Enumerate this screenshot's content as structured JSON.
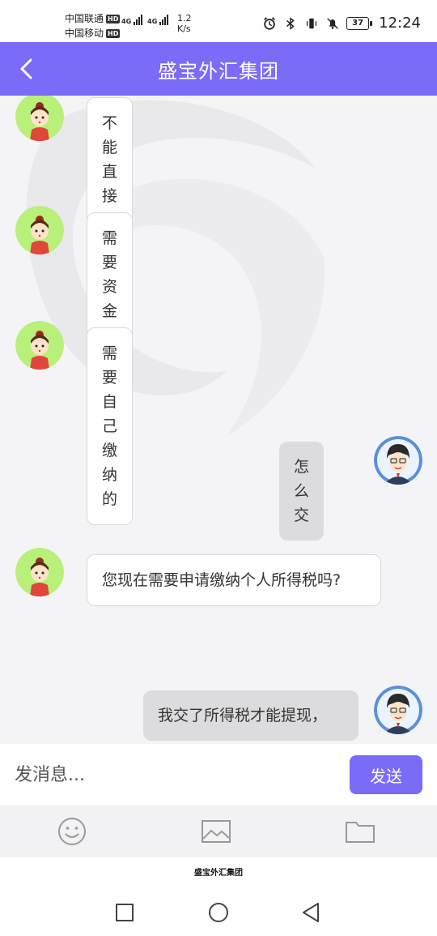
{
  "status_bar": {
    "carrier1": "中国联通",
    "carrier2": "中国移动",
    "hd": "HD",
    "network1": "4G",
    "network2": "4G",
    "speed_value": "1.2",
    "speed_unit": "K/s",
    "battery": "37",
    "time": "12:24"
  },
  "header": {
    "title": "盛宝外汇集团"
  },
  "messages": [
    {
      "side": "left",
      "text": "不能直接扣除"
    },
    {
      "side": "left",
      "text": "需要资金缴纳"
    },
    {
      "side": "left",
      "text": "需要自己缴纳的"
    },
    {
      "side": "right",
      "text": "怎么交"
    },
    {
      "side": "left",
      "text": "您现在需要申请缴纳个人所得税吗?"
    },
    {
      "side": "right",
      "text": "我交了所得税才能提现，"
    }
  ],
  "input": {
    "placeholder": "发消息...",
    "value": ""
  },
  "send": {
    "label": "发送"
  },
  "toolbar": {
    "icons": [
      "emoji-icon",
      "image-icon",
      "folder-icon"
    ]
  },
  "footer": {
    "label": "盛宝外汇集团"
  },
  "colors": {
    "accent": "#7a6cf7",
    "bubble_left": "#ffffff",
    "bubble_right": "#dcdcde"
  }
}
